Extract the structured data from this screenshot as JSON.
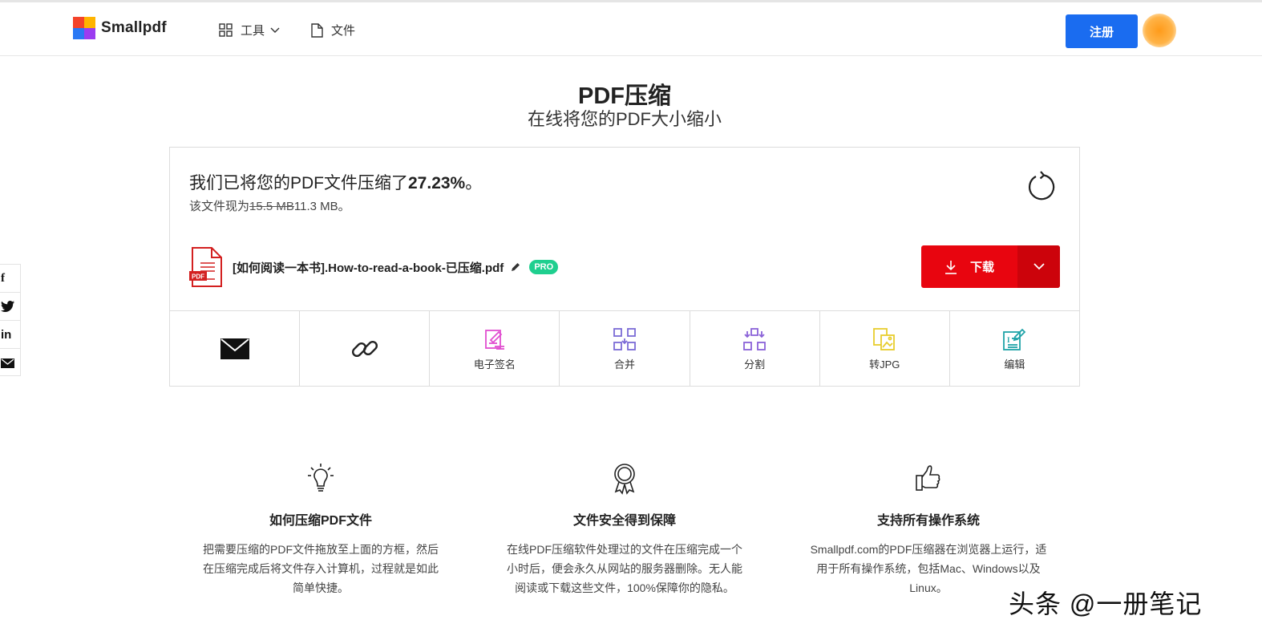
{
  "brand": {
    "name": "Smallpdf"
  },
  "nav": {
    "tools_label": "工具",
    "files_label": "文件",
    "signup_label": "注册"
  },
  "page": {
    "title": "PDF压缩",
    "subtitle": "在线将您的PDF大小缩小"
  },
  "result": {
    "headline_prefix": "我们已将您的PDF文件压缩了",
    "percent": "27.23%",
    "headline_suffix": "。",
    "size_prefix": "该文件现为",
    "old_size": "15.5 MB",
    "new_size": "11.3 MB",
    "size_suffix": "。"
  },
  "file": {
    "name": "[如何阅读一本书].How-to-read-a-book-已压缩.pdf",
    "icon_text": "PDF",
    "badge": "PRO"
  },
  "download": {
    "label": "下载"
  },
  "actions": [
    {
      "id": "email",
      "label": "",
      "icon": "envelope-icon"
    },
    {
      "id": "link",
      "label": "",
      "icon": "link-icon"
    },
    {
      "id": "esign",
      "label": "电子签名",
      "icon": "esign-icon",
      "color": "#e14fd0"
    },
    {
      "id": "merge",
      "label": "合并",
      "icon": "merge-icon",
      "color": "#7b6bd6"
    },
    {
      "id": "split",
      "label": "分割",
      "icon": "split-icon",
      "color": "#8a62d8"
    },
    {
      "id": "tojpg",
      "label": "转JPG",
      "icon": "jpg-icon",
      "color": "#e8cd2e"
    },
    {
      "id": "edit",
      "label": "编辑",
      "icon": "edit-pdf-icon",
      "color": "#1fa3a8"
    }
  ],
  "social": [
    "f",
    "twitter-icon",
    "in",
    "mail-icon"
  ],
  "features": [
    {
      "title": "如何压缩PDF文件",
      "text": "把需要压缩的PDF文件拖放至上面的方框，然后在压缩完成后将文件存入计算机，过程就是如此简单快捷。",
      "icon": "lightbulb-icon"
    },
    {
      "title": "文件安全得到保障",
      "text": "在线PDF压缩软件处理过的文件在压缩完成一个小时后，便会永久从网站的服务器删除。无人能阅读或下载这些文件，100%保障你的隐私。",
      "icon": "award-icon"
    },
    {
      "title": "支持所有操作系统",
      "text": "Smallpdf.com的PDF压缩器在浏览器上运行，适用于所有操作系统，包括Mac、Windows以及Linux。",
      "icon": "thumbs-up-icon"
    }
  ],
  "watermark": "头条 @一册笔记",
  "colors": {
    "primary_blue": "#1a6cf0",
    "download_red": "#e8050f",
    "pro_green": "#1fcf8f"
  }
}
